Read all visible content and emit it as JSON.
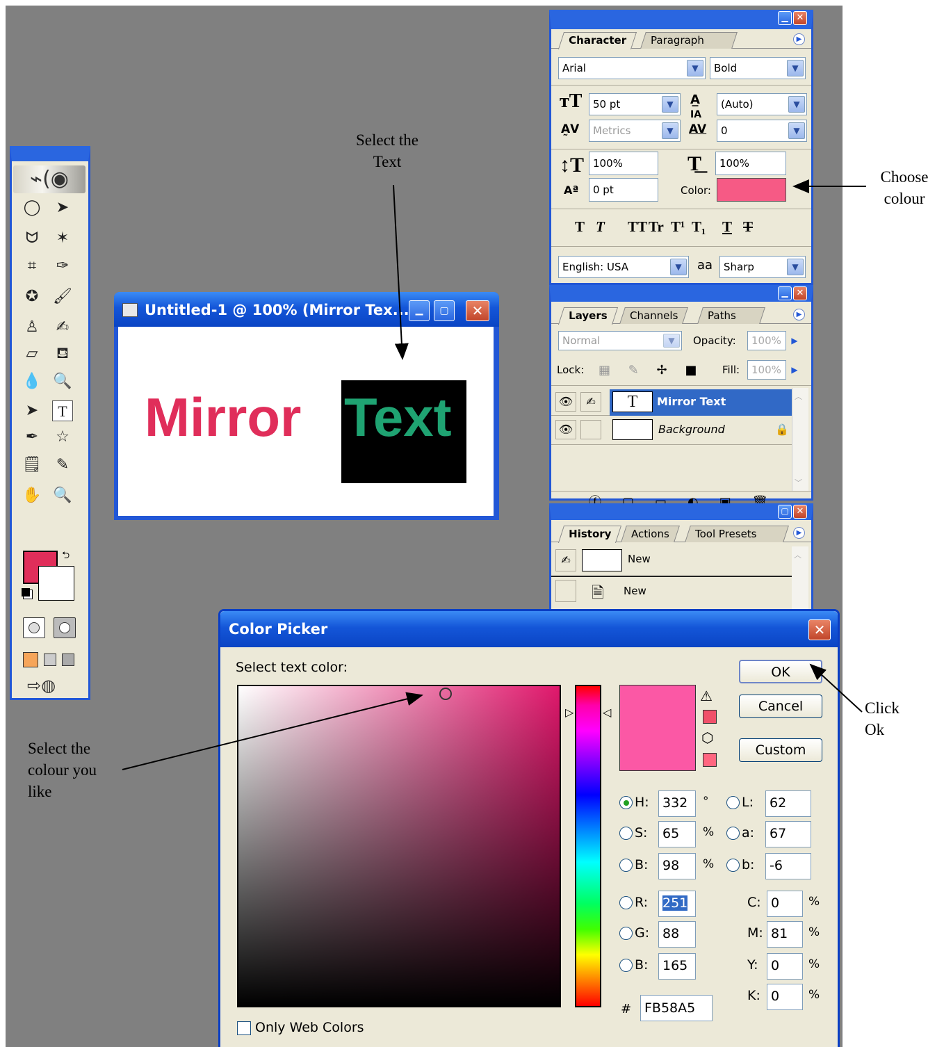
{
  "annotations": {
    "select_text": "Select the\nText",
    "choose_colour": "Choose\ncolour",
    "select_colour": "Select the\ncolour you\nlike",
    "click_ok": "Click\nOk"
  },
  "toolbox": {
    "tools": [
      "marquee-icon",
      "move-icon",
      "lasso-icon",
      "magic-wand-icon",
      "crop-icon",
      "slice-icon",
      "healing-icon",
      "brush-icon",
      "stamp-icon",
      "history-brush-icon",
      "eraser-icon",
      "bucket-icon",
      "blur-icon",
      "dodge-icon",
      "path-select-icon",
      "type-icon",
      "pen-icon",
      "shape-icon",
      "notes-icon",
      "eyedropper-icon",
      "hand-icon",
      "zoom-icon"
    ],
    "type_tool_glyph": "T",
    "foreground_color": "#e02e5a",
    "background_color": "#ffffff"
  },
  "document": {
    "title": "Untitled-1 @ 100% (Mirror Tex...",
    "word1": "Mirror",
    "word2": "Text",
    "word1_color": "#e02e5a",
    "word2_color": "#1fa372"
  },
  "character_panel": {
    "tabs": [
      "Character",
      "Paragraph"
    ],
    "font_family": "Arial",
    "font_style": "Bold",
    "size": "50 pt",
    "leading": "(Auto)",
    "kerning": "Metrics",
    "tracking": "0",
    "vertical_scale": "100%",
    "horizontal_scale": "100%",
    "baseline_shift": "0 pt",
    "color_label": "Color:",
    "color_value": "#f65a85",
    "style_buttons": [
      "T",
      "T",
      "TT",
      "Tr",
      "T¹",
      "T₁",
      "T",
      "T"
    ],
    "language": "English: USA",
    "aa_icon": "aa",
    "antialias": "Sharp"
  },
  "layers_panel": {
    "tabs": [
      "Layers",
      "Channels",
      "Paths"
    ],
    "blend_mode": "Normal",
    "opacity_label": "Opacity:",
    "opacity": "100%",
    "lock_label": "Lock:",
    "fill_label": "Fill:",
    "fill": "100%",
    "layers": [
      {
        "name": "Mirror Text",
        "thumb": "T",
        "selected": true
      },
      {
        "name": "Background",
        "thumb": "",
        "selected": false
      }
    ]
  },
  "history_panel": {
    "tabs": [
      "History",
      "Actions",
      "Tool Presets"
    ],
    "snapshot": "New",
    "items": [
      "New"
    ]
  },
  "color_picker": {
    "title": "Color Picker",
    "prompt": "Select text color:",
    "ok": "OK",
    "cancel": "Cancel",
    "custom": "Custom",
    "swatch_color": "#fb58a5",
    "fields": {
      "H": {
        "label": "H:",
        "value": "332",
        "unit": "°"
      },
      "S": {
        "label": "S:",
        "value": "65",
        "unit": "%"
      },
      "B": {
        "label": "B:",
        "value": "98",
        "unit": "%"
      },
      "R": {
        "label": "R:",
        "value": "251"
      },
      "G": {
        "label": "G:",
        "value": "88"
      },
      "Bl": {
        "label": "B:",
        "value": "165"
      },
      "L": {
        "label": "L:",
        "value": "62"
      },
      "a": {
        "label": "a:",
        "value": "67"
      },
      "b": {
        "label": "b:",
        "value": "-6"
      },
      "C": {
        "label": "C:",
        "value": "0",
        "unit": "%"
      },
      "M": {
        "label": "M:",
        "value": "81",
        "unit": "%"
      },
      "Y": {
        "label": "Y:",
        "value": "0",
        "unit": "%"
      },
      "K": {
        "label": "K:",
        "value": "0",
        "unit": "%"
      }
    },
    "hex_label": "#",
    "hex": "FB58A5",
    "web_only_label": "Only Web Colors"
  }
}
